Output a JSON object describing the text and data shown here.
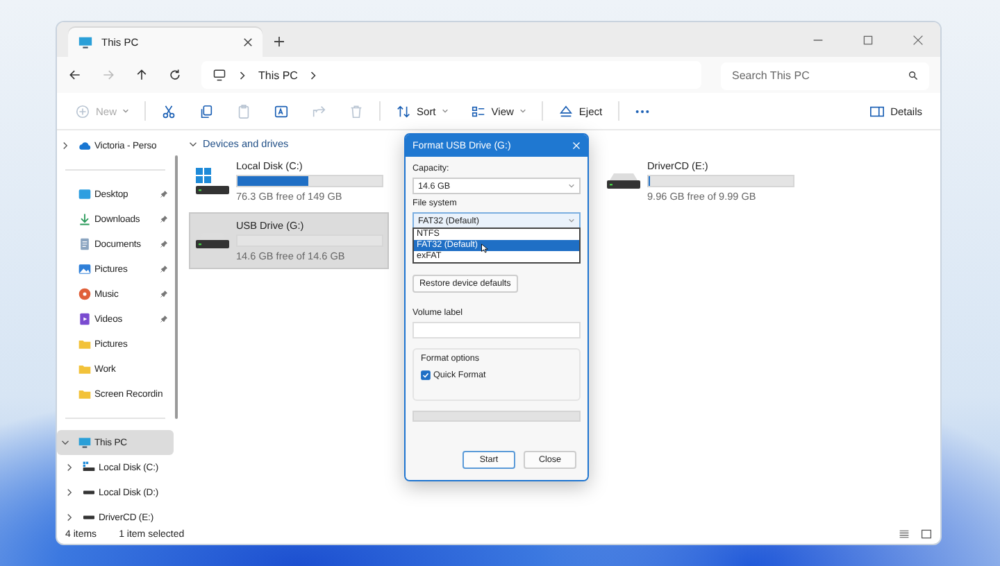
{
  "window": {
    "tab": {
      "title": "This PC",
      "selected": true
    }
  },
  "navigation": {
    "buttons": [
      {
        "kind": "back",
        "disabled": false
      },
      {
        "kind": "forward",
        "disabled": true
      },
      {
        "kind": "up",
        "disabled": false
      },
      {
        "kind": "refresh",
        "disabled": false
      }
    ],
    "address": "This PC",
    "search": {
      "placeholder": "Search This PC"
    }
  },
  "toolbar": {
    "groups": [
      [
        {
          "kind": "new",
          "label": "New",
          "disabled": true,
          "caret": true
        }
      ],
      [
        {
          "kind": "cut",
          "disabled": false
        },
        {
          "kind": "copy",
          "disabled": false
        },
        {
          "kind": "paste",
          "disabled": true
        },
        {
          "kind": "rename",
          "disabled": false
        },
        {
          "kind": "share",
          "disabled": true
        },
        {
          "kind": "delete",
          "disabled": true
        }
      ],
      [
        {
          "kind": "sort",
          "label": "Sort",
          "disabled": false,
          "caret": true
        },
        {
          "kind": "view",
          "label": "View",
          "disabled": false,
          "caret": true
        }
      ],
      [
        {
          "kind": "eject",
          "label": "Eject",
          "disabled": false
        }
      ],
      [
        {
          "kind": "more",
          "disabled": false
        }
      ]
    ],
    "details": "Details"
  },
  "sidebar": {
    "sections": [
      [
        {
          "label": "Victoria - Perso",
          "kind": "cloud",
          "pinned": false,
          "expandable": true,
          "selected": false
        }
      ],
      [
        {
          "label": "Desktop",
          "kind": "desktop",
          "pinned": true,
          "selected": false
        },
        {
          "label": "Downloads",
          "kind": "download",
          "pinned": true,
          "selected": false
        },
        {
          "label": "Documents",
          "kind": "documents",
          "pinned": true,
          "selected": false
        },
        {
          "label": "Pictures",
          "kind": "pictures",
          "pinned": true,
          "selected": false
        },
        {
          "label": "Music",
          "kind": "music",
          "pinned": true,
          "selected": false
        },
        {
          "label": "Videos",
          "kind": "videos",
          "pinned": true,
          "selected": false
        },
        {
          "label": "Pictures",
          "kind": "folder",
          "pinned": false,
          "selected": false
        },
        {
          "label": "Work",
          "kind": "folder",
          "pinned": false,
          "selected": false
        },
        {
          "label": "Screen Recordin",
          "kind": "folder",
          "pinned": false,
          "selected": false
        }
      ],
      [
        {
          "label": "This PC",
          "kind": "pc",
          "pinned": false,
          "expandable": true,
          "expanded": true,
          "selected": true,
          "children": [
            {
              "label": "Local Disk (C:)",
              "kind": "windows-disk",
              "expandable": true,
              "selected": false
            },
            {
              "label": "Local Disk (D:)",
              "kind": "disk",
              "expandable": true,
              "selected": false
            },
            {
              "label": "DriverCD (E:)",
              "kind": "disk",
              "expandable": true,
              "selected": false
            }
          ]
        }
      ]
    ]
  },
  "content": {
    "section": "Devices and drives",
    "drives": [
      {
        "name": "Local Disk (C:)",
        "kind": "windows-disk",
        "level": 0.49,
        "free": "76.3 GB free of 149 GB",
        "selected": false
      },
      {
        "name": "USB Drive (G:)",
        "kind": "disk",
        "level": 0,
        "free": "14.6 GB free of 14.6 GB",
        "selected": true
      },
      {
        "name": "DriverCD (E:)",
        "kind": "disk",
        "level": 0.01,
        "free": "9.96 GB free of 9.99 GB",
        "selected": false
      }
    ]
  },
  "dialog": {
    "title": "Format USB Drive (G:)",
    "capacity_label": "Capacity:",
    "capacity": "14.6 GB",
    "file_system_label": "File system",
    "file_system": "FAT32 (Default)",
    "file_system_options": [
      {
        "label": "NTFS",
        "selected": false
      },
      {
        "label": "FAT32 (Default)",
        "selected": true
      },
      {
        "label": "exFAT",
        "selected": false
      }
    ],
    "restore_button": "Restore device defaults",
    "volume_label": "Volume label",
    "format_options_label": "Format options",
    "quick_format": {
      "label": "Quick Format",
      "checked": true
    },
    "progress": {
      "level": 0
    },
    "buttons": [
      {
        "label": "Start",
        "default": true
      },
      {
        "label": "Close",
        "default": false
      }
    ]
  },
  "status_bar": {
    "items": "4 items",
    "selection": "1 item selected"
  }
}
